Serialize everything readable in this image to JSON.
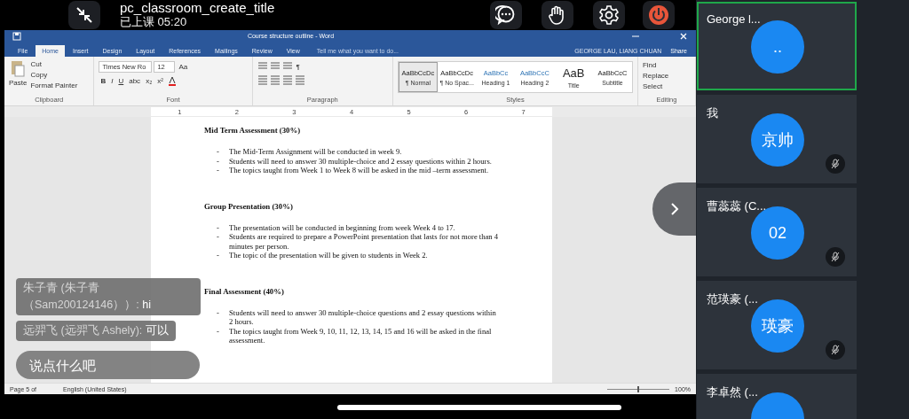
{
  "app_bar": {
    "title": "pc_classroom_create_title",
    "status": "已上课 05:20"
  },
  "word": {
    "title": "Course structure outline - Word",
    "user": "GEORGE LAU, LIANG CHUAN",
    "share": "Share",
    "tabs": [
      {
        "label": "File",
        "selected": false
      },
      {
        "label": "Home",
        "selected": true
      },
      {
        "label": "Insert",
        "selected": false
      },
      {
        "label": "Design",
        "selected": false
      },
      {
        "label": "Layout",
        "selected": false
      },
      {
        "label": "References",
        "selected": false
      },
      {
        "label": "Mailings",
        "selected": false
      },
      {
        "label": "Review",
        "selected": false
      },
      {
        "label": "View",
        "selected": false
      }
    ],
    "tell_me": "Tell me what you want to do...",
    "ribbon": {
      "clipboard": {
        "paste": "Paste",
        "cut": "Cut",
        "copy": "Copy",
        "format_painter": "Format Painter",
        "label": "Clipboard"
      },
      "font": {
        "name": "Times New Ro",
        "size": "12",
        "case": "Aa",
        "format_buttons": [
          "B",
          "I",
          "U",
          "abc",
          "x₂",
          "x²"
        ],
        "label": "Font"
      },
      "paragraph": {
        "pilcrow": "¶",
        "label": "Paragraph"
      },
      "styles": {
        "label": "Styles",
        "items": [
          {
            "preview": "AaBbCcDc",
            "name": "¶ Normal",
            "selected": true
          },
          {
            "preview": "AaBbCcDc",
            "name": "¶ No Spac...",
            "selected": false
          },
          {
            "preview": "AaBbCc",
            "name": "Heading 1",
            "selected": false
          },
          {
            "preview": "AaBbCcC",
            "name": "Heading 2",
            "selected": false
          },
          {
            "preview": "AaB",
            "name": "Title",
            "selected": false
          },
          {
            "preview": "AaBbCcC",
            "name": "Subtitle",
            "selected": false
          }
        ]
      },
      "editing": {
        "label": "Editing",
        "items": [
          "Find",
          "Replace",
          "Select"
        ]
      }
    },
    "ruler": [
      "1",
      "2",
      "3",
      "4",
      "5",
      "6",
      "7"
    ],
    "document": {
      "sections": [
        {
          "heading": "Mid Term Assessment (30%)",
          "marker": "-",
          "items": [
            "The Mid-Term Assignment will be conducted in week 9.",
            "Students will need to answer 30 multiple-choice and 2 essay questions within 2 hours.",
            "The topics taught from Week 1 to Week 8 will be asked in the mid –term assessment."
          ]
        },
        {
          "heading": "Group Presentation (30%)",
          "marker": "-",
          "items": [
            "The presentation will be conducted in beginning from week Week 4 to 17.",
            "Students are required to prepare a PowerPoint presentation that lasts for not more than 4 minutes per person.",
            "The topic of the presentation will be given to students in Week 2."
          ]
        },
        {
          "heading": "Final Assessment (40%)",
          "marker": "-",
          "items": [
            "Students will need to answer 30 multiple-choice questions and 2 essay questions within 2 hours.",
            "The topics taught from Week 9, 10, 11, 12, 13, 14, 15 and 16 will be asked in the final assessment."
          ]
        }
      ]
    },
    "status_bar": {
      "page": "Page 5 of",
      "language": "English (United States)",
      "zoom": "100%",
      "level": 0.5
    }
  },
  "chat": {
    "messages": [
      {
        "sender": "朱子青 (朱子青（Sam200124146））:",
        "text": "hi"
      },
      {
        "sender": "远羿飞 (远羿飞 Ashely):",
        "text": "可以"
      }
    ],
    "input": {
      "placeholder": "说点什么吧"
    }
  },
  "participants": [
    {
      "name": "George l...",
      "avatar": "..",
      "speaking": true,
      "muted": false
    },
    {
      "name": "我",
      "avatar": "京帅",
      "speaking": false,
      "muted": true
    },
    {
      "name": "曹蕊蕊 (C...",
      "avatar": "02",
      "speaking": false,
      "muted": true
    },
    {
      "name": "范瑛豪 (...",
      "avatar": "瑛豪",
      "speaking": false,
      "muted": true
    },
    {
      "name": "李卓然 (...",
      "speaking": false,
      "muted": false
    }
  ]
}
